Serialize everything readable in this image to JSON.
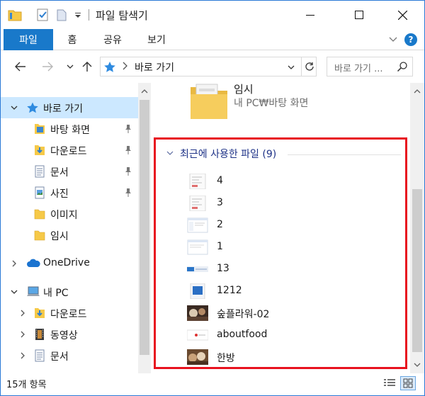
{
  "window": {
    "title": "파일 탐색기"
  },
  "ribbon": {
    "tabs": [
      "파일",
      "홈",
      "공유",
      "보기"
    ],
    "accent": "#1979ca",
    "help_label": "?"
  },
  "address": {
    "path": "바로 가기",
    "search_placeholder": "바로 가기 ..."
  },
  "navpane": {
    "items": [
      {
        "label": "바로 가기",
        "icon": "star-icon",
        "pinned": false,
        "selected": true
      },
      {
        "label": "바탕 화면",
        "icon": "desktop-folder-icon",
        "pinned": true
      },
      {
        "label": "다운로드",
        "icon": "downloads-folder-icon",
        "pinned": true
      },
      {
        "label": "문서",
        "icon": "documents-folder-icon",
        "pinned": true
      },
      {
        "label": "사진",
        "icon": "pictures-folder-icon",
        "pinned": true
      },
      {
        "label": "이미지",
        "icon": "folder-icon",
        "pinned": false
      },
      {
        "label": "임시",
        "icon": "folder-icon",
        "pinned": false
      },
      {
        "label": "OneDrive",
        "icon": "cloud-icon",
        "pinned": false
      },
      {
        "label": "내 PC",
        "icon": "computer-icon",
        "pinned": false
      },
      {
        "label": "다운로드",
        "icon": "downloads-folder-icon",
        "pinned": false
      },
      {
        "label": "동영상",
        "icon": "videos-folder-icon",
        "pinned": false
      },
      {
        "label": "문서",
        "icon": "documents-folder-icon",
        "pinned": false
      }
    ]
  },
  "content": {
    "folder": {
      "name": "임시",
      "location": "내 PC₩바탕 화면"
    },
    "recent_group": {
      "heading": "최근에 사용한 파일 (9)",
      "highlight_color": "#e8121f",
      "files": [
        {
          "name": "4",
          "thumb": "document-thumb"
        },
        {
          "name": "3",
          "thumb": "document-thumb"
        },
        {
          "name": "2",
          "thumb": "screenshot-thumb"
        },
        {
          "name": "1",
          "thumb": "screenshot-thumb"
        },
        {
          "name": "13",
          "thumb": "windows-banner-thumb"
        },
        {
          "name": "1212",
          "thumb": "blue-app-thumb"
        },
        {
          "name": "숲플라워-02",
          "thumb": "photo-thumb"
        },
        {
          "name": "aboutfood",
          "thumb": "white-logo-thumb"
        },
        {
          "name": "한방",
          "thumb": "photo-thumb"
        }
      ]
    }
  },
  "status": {
    "item_count": "15개 항목"
  }
}
